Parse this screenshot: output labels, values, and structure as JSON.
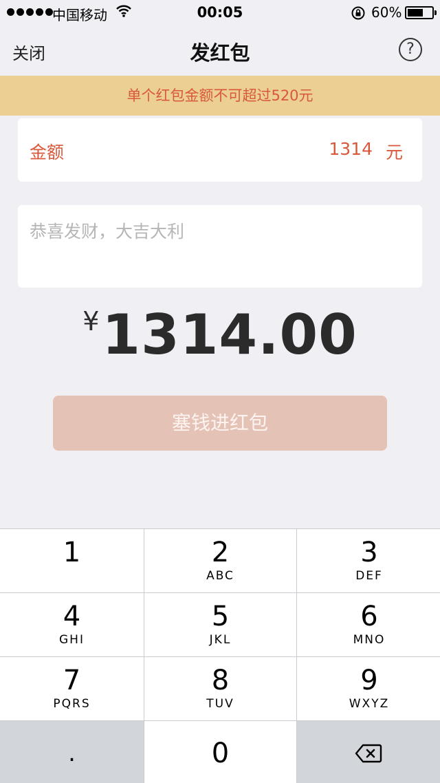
{
  "status_bar": {
    "carrier": "中国移动",
    "time": "00:05",
    "battery": "60%",
    "battery_level": 0.6,
    "icons": [
      "signal-dots-icon",
      "wifi-icon",
      "rotation-lock-icon",
      "battery-icon"
    ]
  },
  "nav": {
    "close_label": "关闭",
    "title": "发红包",
    "help_icon": "question-circle-icon",
    "help_label": "?"
  },
  "banner": {
    "text": "单个红包金额不可超过520元"
  },
  "amount": {
    "label": "金额",
    "value": "1314",
    "unit": "元"
  },
  "greeting": {
    "placeholder": "恭喜发财，大吉大利",
    "value": ""
  },
  "total": {
    "currency": "¥",
    "value": "1314.00"
  },
  "submit": {
    "label": "塞钱进红包"
  },
  "keypad": {
    "keys": [
      {
        "digit": "1",
        "letters": ""
      },
      {
        "digit": "2",
        "letters": "ABC"
      },
      {
        "digit": "3",
        "letters": "DEF"
      },
      {
        "digit": "4",
        "letters": "GHI"
      },
      {
        "digit": "5",
        "letters": "JKL"
      },
      {
        "digit": "6",
        "letters": "MNO"
      },
      {
        "digit": "7",
        "letters": "PQRS"
      },
      {
        "digit": "8",
        "letters": "TUV"
      },
      {
        "digit": "9",
        "letters": "WXYZ"
      }
    ],
    "decimal": ".",
    "zero": "0",
    "delete_icon": "backspace-icon"
  },
  "colors": {
    "accent": "#d9583b",
    "banner_bg": "#eccf93",
    "button_bg": "#e5c2b6",
    "page_bg": "#efeff4"
  }
}
